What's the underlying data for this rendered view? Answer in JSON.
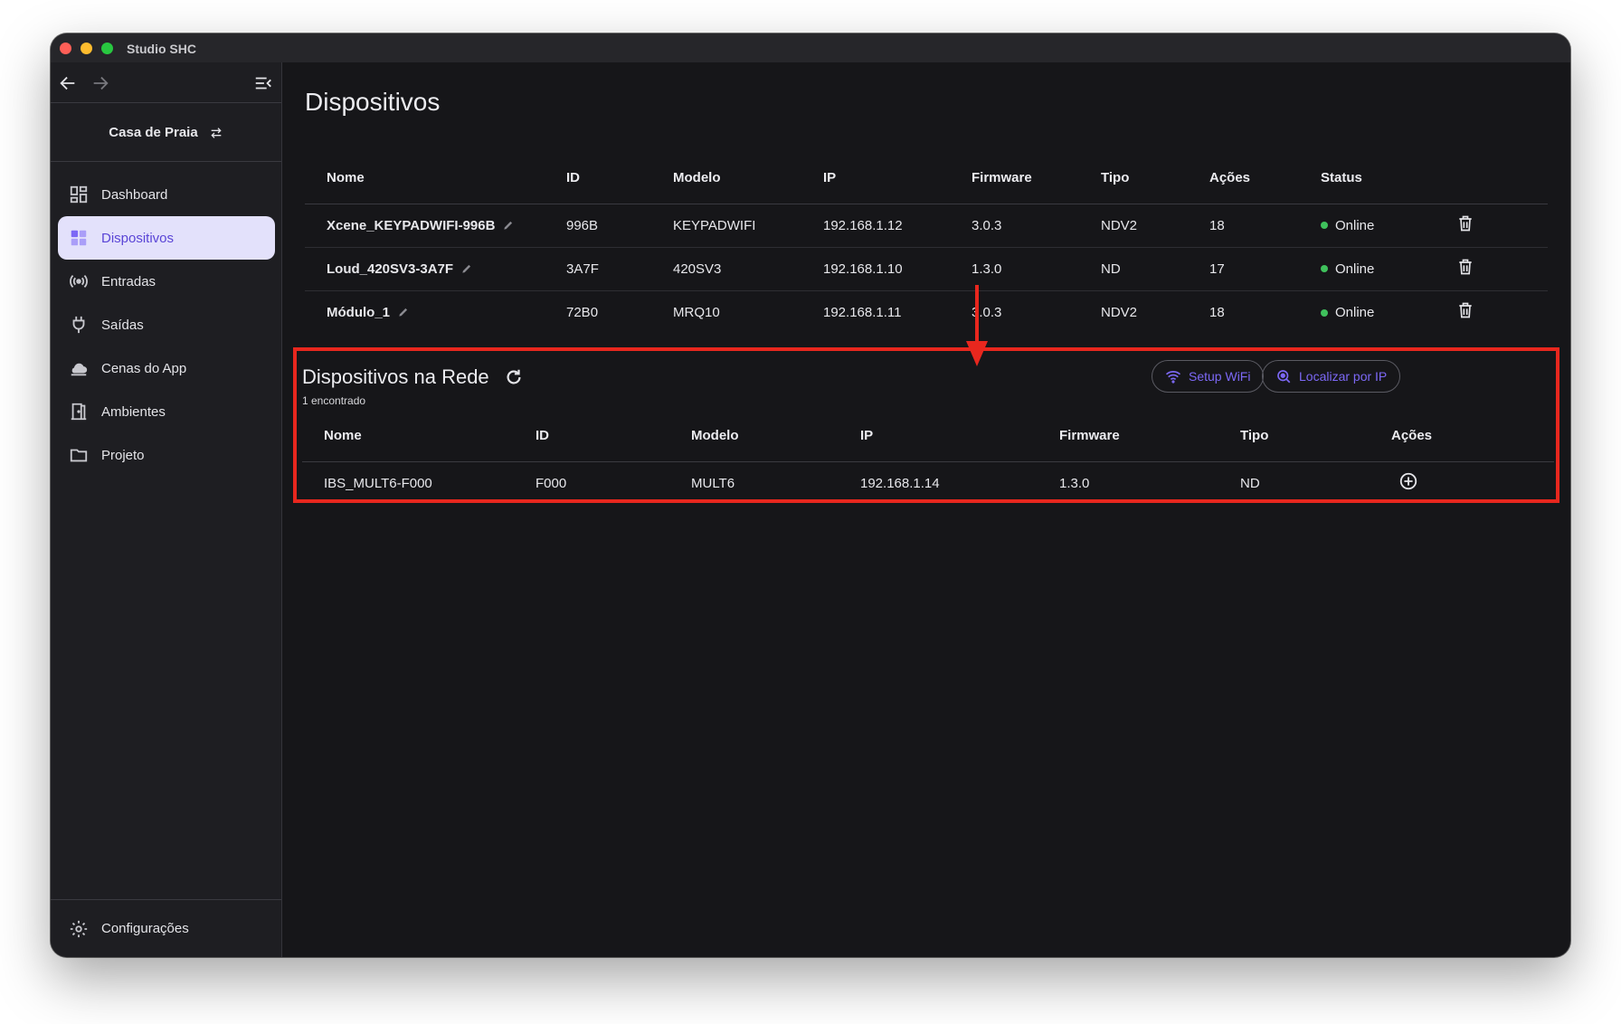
{
  "app": {
    "title": "Studio SHC"
  },
  "sidebar": {
    "project_name": "Casa de Praia",
    "items": [
      {
        "label": "Dashboard",
        "icon": "dashboard-icon",
        "active": false
      },
      {
        "label": "Dispositivos",
        "icon": "devices-icon",
        "active": true
      },
      {
        "label": "Entradas",
        "icon": "broadcast-icon",
        "active": false
      },
      {
        "label": "Saídas",
        "icon": "plug-icon",
        "active": false
      },
      {
        "label": "Cenas do App",
        "icon": "cloud-icon",
        "active": false
      },
      {
        "label": "Ambientes",
        "icon": "door-icon",
        "active": false
      },
      {
        "label": "Projeto",
        "icon": "folder-icon",
        "active": false
      }
    ],
    "settings_label": "Configurações"
  },
  "devices": {
    "title": "Dispositivos",
    "headers": [
      "Nome",
      "ID",
      "Modelo",
      "IP",
      "Firmware",
      "Tipo",
      "Ações",
      "Status"
    ],
    "rows": [
      {
        "name": "Xcene_KEYPADWIFI-996B",
        "id": "996B",
        "model": "KEYPADWIFI",
        "ip": "192.168.1.12",
        "firmware": "3.0.3",
        "type": "NDV2",
        "actions": "18",
        "status": "Online"
      },
      {
        "name": "Loud_420SV3-3A7F",
        "id": "3A7F",
        "model": "420SV3",
        "ip": "192.168.1.10",
        "firmware": "1.3.0",
        "type": "ND",
        "actions": "17",
        "status": "Online"
      },
      {
        "name": "Módulo_1",
        "id": "72B0",
        "model": "MRQ10",
        "ip": "192.168.1.11",
        "firmware": "3.0.3",
        "type": "NDV2",
        "actions": "18",
        "status": "Online"
      }
    ]
  },
  "network": {
    "title": "Dispositivos na Rede",
    "count": "1 encontrado",
    "setup_wifi_label": "Setup WiFi",
    "locate_ip_label": "Localizar por IP",
    "headers": [
      "Nome",
      "ID",
      "Modelo",
      "IP",
      "Firmware",
      "Tipo",
      "Ações"
    ],
    "rows": [
      {
        "name": "IBS_MULT6-F000",
        "id": "F000",
        "model": "MULT6",
        "ip": "192.168.1.14",
        "firmware": "1.3.0",
        "type": "ND"
      }
    ]
  },
  "colors": {
    "accent": "#7c68f5",
    "active_bg": "#e3e1fb",
    "highlight": "#e8271e",
    "online": "#3fc15c"
  }
}
